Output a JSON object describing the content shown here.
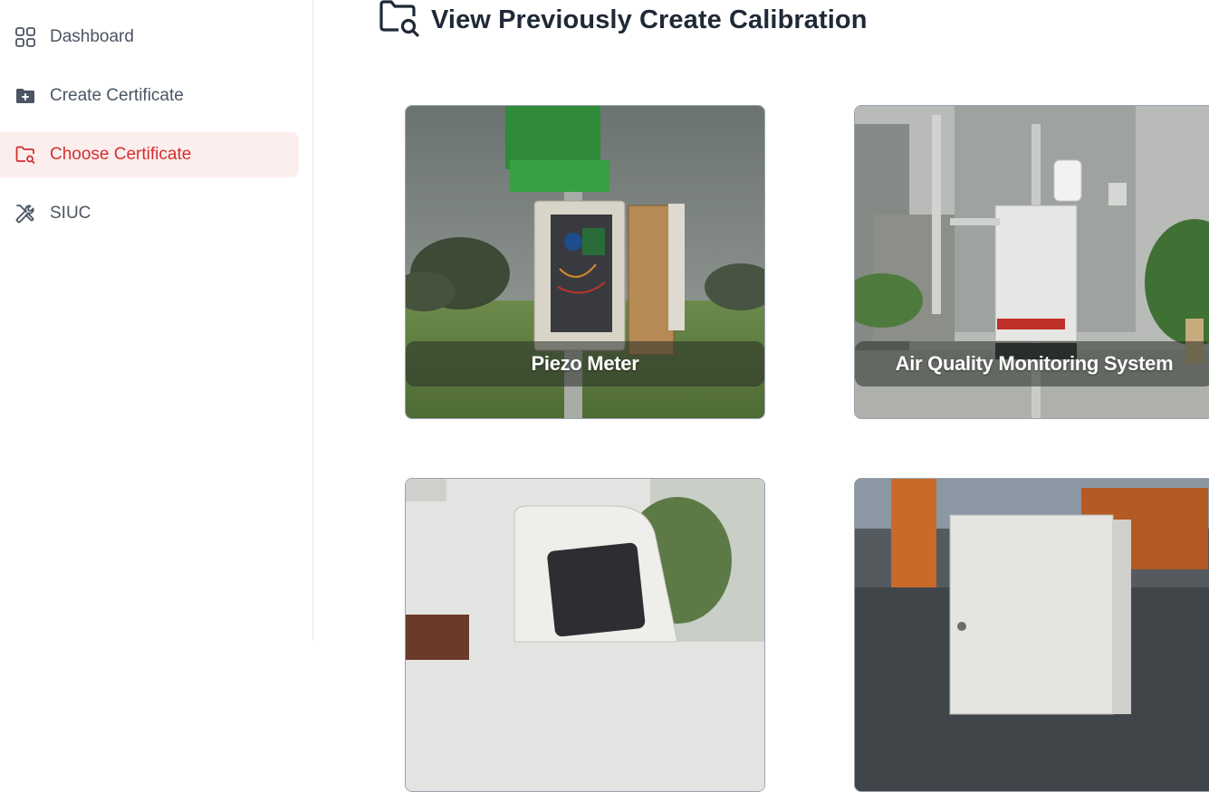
{
  "sidebar": {
    "items": [
      {
        "label": "Dashboard",
        "icon": "dashboard-grid-icon"
      },
      {
        "label": "Create Certificate",
        "icon": "folder-plus-icon"
      },
      {
        "label": "Choose Certificate",
        "icon": "folder-search-icon",
        "active": true
      },
      {
        "label": "SIUC",
        "icon": "tools-icon"
      }
    ]
  },
  "header": {
    "title": "View Previously Create Calibration",
    "icon": "folder-search-icon"
  },
  "cards": [
    {
      "caption": "Piezo Meter"
    },
    {
      "caption": "Air Quality Monitoring System"
    },
    {
      "caption": ""
    },
    {
      "caption": ""
    }
  ],
  "colors": {
    "accent": "#d32f2f",
    "active_bg": "#fdeeee",
    "text": "#1f2937"
  }
}
